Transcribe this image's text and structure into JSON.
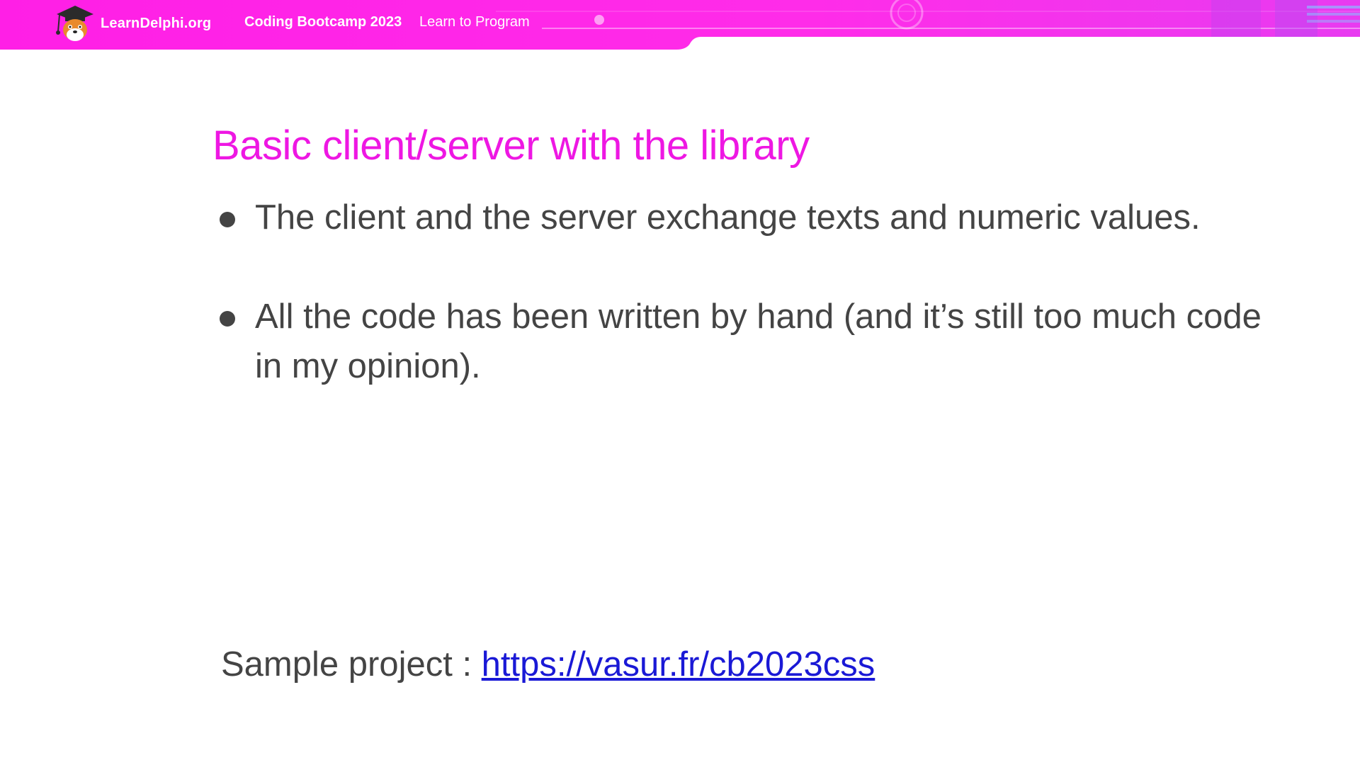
{
  "header": {
    "brand": "LearnDelphi.org",
    "course": "Coding Bootcamp 2023",
    "tagline": "Learn to Program",
    "logo_icon": "graduation-cap-mascot-icon"
  },
  "colors": {
    "banner": "#ff22e8",
    "title": "#ee17e3",
    "body_text": "#444444",
    "link": "#1a19d6"
  },
  "slide": {
    "title": "Basic client/server with the library",
    "bullets": [
      "The client and the server exchange texts and numeric values.",
      "All the code has been written by hand (and it’s still too much code in my opinion)."
    ],
    "sample_label": "Sample project : ",
    "sample_link": "https://vasur.fr/cb2023css"
  }
}
